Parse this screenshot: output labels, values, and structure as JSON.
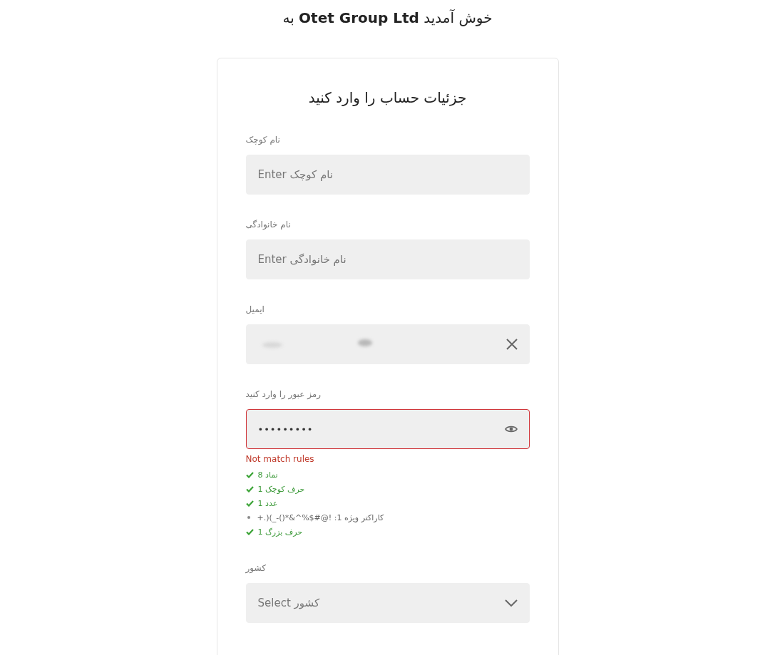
{
  "title": "خوش آمدید **Otet Group Ltd** به",
  "card": {
    "heading": "جزئیات حساب را وارد کنید",
    "fields": [
      {
        "kind": "text",
        "label": "نام کوچک",
        "placeholder": "Enter نام کوچک"
      },
      {
        "kind": "text",
        "label": "نام خانوادگی",
        "placeholder": "Enter نام خانوادگی"
      },
      {
        "kind": "email",
        "label": "ایمیل",
        "blurred": true
      },
      {
        "kind": "password",
        "label": "رمز عبور را وارد کنید",
        "value": "•••••••••",
        "error": "Not match rules",
        "rules": [
          {
            "text": "نماد 8",
            "met": true
          },
          {
            "text": "حرف کوچک 1",
            "met": true
          },
          {
            "text": "عدد 1",
            "met": true
          },
          {
            "text": "کاراکتر ویژه 1: !@#$%^&*()-_)(.+",
            "met": false
          },
          {
            "text": "حرف بزرگ 1",
            "met": true
          }
        ]
      },
      {
        "kind": "select",
        "label": "کشور",
        "placeholder": "Select کشور"
      }
    ]
  }
}
